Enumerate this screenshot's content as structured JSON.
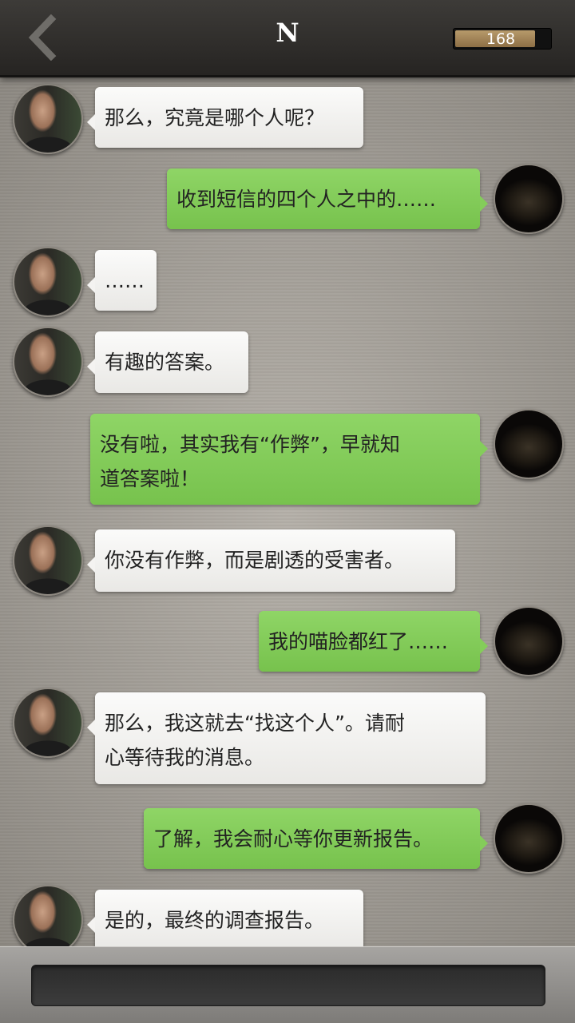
{
  "header": {
    "title": "N",
    "back_icon": "chevron-left-icon",
    "counter_value": "168",
    "counter_fill_fraction": 0.85,
    "counter_fill_color": "#a6875a"
  },
  "messages": [
    {
      "side": "left",
      "text": "那么，究竟是哪个人呢？"
    },
    {
      "side": "right",
      "text": "收到短信的四个人之中的……"
    },
    {
      "side": "left",
      "text": "……"
    },
    {
      "side": "left",
      "text": "有趣的答案。"
    },
    {
      "side": "right",
      "text": "没有啦，其实我有“作弊”，早就知\n道答案啦！"
    },
    {
      "side": "left",
      "text": "你没有作弊，而是剧透的受害者。"
    },
    {
      "side": "right",
      "text": "我的喵脸都红了……"
    },
    {
      "side": "left",
      "text": "那么，我这就去“找这个人”。请耐\n心等待我的消息。"
    },
    {
      "side": "right",
      "text": "了解，我会耐心等你更新报告。"
    },
    {
      "side": "left",
      "text": "是的，最终的调查报告。"
    }
  ],
  "colors": {
    "right_bubble": "#82cb59",
    "left_bubble": "#f2f1ef",
    "top_bar": "#2f2d2a"
  }
}
